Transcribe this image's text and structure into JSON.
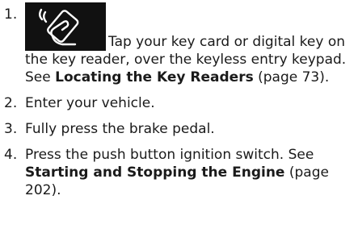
{
  "steps": [
    {
      "number": "1.",
      "icon": "key-card-tap-icon",
      "text_before": "Tap your key card or digital key on the key reader, over the keyless entry keypad. See ",
      "link": "Locating the Key Readers",
      "text_after": " (page 73)."
    },
    {
      "number": "2.",
      "text": "Enter your vehicle."
    },
    {
      "number": "3.",
      "text": "Fully press the brake pedal."
    },
    {
      "number": "4.",
      "text_before": "Press the push button ignition switch. See ",
      "link": "Starting and Stopping the Engine",
      "text_after": " (page 202)."
    }
  ]
}
